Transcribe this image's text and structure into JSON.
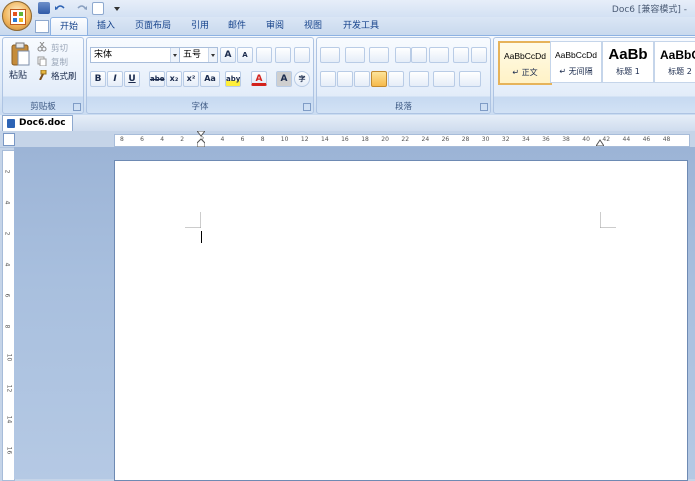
{
  "title_bar": {
    "doc_title": "Doc6 [兼容模式] -"
  },
  "tabs": [
    {
      "label": "开始",
      "active": true
    },
    {
      "label": "插入"
    },
    {
      "label": "页面布局"
    },
    {
      "label": "引用"
    },
    {
      "label": "邮件"
    },
    {
      "label": "审阅"
    },
    {
      "label": "视图"
    },
    {
      "label": "开发工具"
    }
  ],
  "clipboard": {
    "paste": "粘贴",
    "cut": "剪切",
    "copy": "复制",
    "format_painter": "格式刷",
    "group_label": "剪贴板"
  },
  "font": {
    "name": "宋体",
    "size": "五号",
    "group_label": "字体",
    "bold": "B",
    "italic": "I",
    "underline": "U",
    "strike": "abe",
    "sub": "x₂",
    "sup": "x²",
    "case": "Aa",
    "grow": "A",
    "shrink": "A",
    "highlight": "aby",
    "color": "A",
    "char_shade": "A",
    "enclose": "字"
  },
  "paragraph": {
    "group_label": "段落"
  },
  "styles": {
    "items": [
      {
        "sample": "AaBbCcDd",
        "name": "↵ 正文"
      },
      {
        "sample": "AaBbCcDd",
        "name": "↵ 无间隔"
      },
      {
        "sample": "AaBb",
        "name": "标题 1"
      },
      {
        "sample": "AaBbC",
        "name": "标题 2"
      }
    ]
  },
  "document_tab": {
    "label": "Doc6.doc"
  },
  "hruler_ticks": [
    "8",
    "6",
    "4",
    "2",
    "2",
    "4",
    "6",
    "8",
    "10",
    "12",
    "14",
    "16",
    "18",
    "20",
    "22",
    "24",
    "26",
    "28",
    "30",
    "32",
    "34",
    "36",
    "38",
    "40",
    "42",
    "44",
    "46",
    "48"
  ],
  "vruler_ticks": [
    "2",
    "4",
    "2",
    "4",
    "6",
    "8",
    "10",
    "12",
    "14",
    "16"
  ],
  "colors": {
    "accent": "#15428b",
    "ribbon_border": "#8db2e3",
    "canvas": "#a8bfde"
  }
}
